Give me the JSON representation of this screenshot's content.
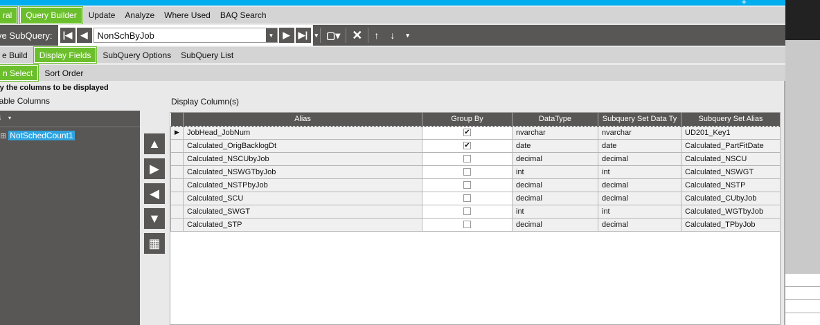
{
  "colors": {
    "accent": "#6cbf2c",
    "titlebar": "#00adef",
    "toolbar": "#595755"
  },
  "main_tabs": [
    {
      "label": "ral",
      "active": true
    },
    {
      "label": "Query Builder",
      "active": true
    },
    {
      "label": "Update"
    },
    {
      "label": "Analyze"
    },
    {
      "label": "Where Used"
    },
    {
      "label": "BAQ Search"
    }
  ],
  "toolbar": {
    "label": "ve SubQuery:",
    "subquery": "NonSchByJob"
  },
  "sub_tabs": [
    {
      "label": "e Build"
    },
    {
      "label": "Display Fields",
      "active": true
    },
    {
      "label": "SubQuery Options"
    },
    {
      "label": "SubQuery List"
    }
  ],
  "subsub_tabs": [
    {
      "label": "n Select",
      "active": true
    },
    {
      "label": "Sort Order"
    }
  ],
  "instruction": "fy the columns to be displayed",
  "available_label": "lable Columns",
  "display_label": "Display Column(s)",
  "tree": {
    "item": "NotSchedCount1"
  },
  "grid": {
    "headers": [
      "Alias",
      "Group By",
      "DataType",
      "Subquery Set Data Ty",
      "Subquery Set Alias"
    ],
    "rows": [
      {
        "alias": "JobHead_JobNum",
        "group_by": true,
        "datatype": "nvarchar",
        "set_type": "nvarchar",
        "set_alias": "UD201_Key1"
      },
      {
        "alias": "Calculated_OrigBacklogDt",
        "group_by": true,
        "datatype": "date",
        "set_type": "date",
        "set_alias": "Calculated_PartFitDate"
      },
      {
        "alias": "Calculated_NSCUbyJob",
        "group_by": false,
        "datatype": "decimal",
        "set_type": "decimal",
        "set_alias": "Calculated_NSCU"
      },
      {
        "alias": "Calculated_NSWGTbyJob",
        "group_by": false,
        "datatype": "int",
        "set_type": "int",
        "set_alias": "Calculated_NSWGT"
      },
      {
        "alias": "Calculated_NSTPbyJob",
        "group_by": false,
        "datatype": "decimal",
        "set_type": "decimal",
        "set_alias": "Calculated_NSTP"
      },
      {
        "alias": "Calculated_SCU",
        "group_by": false,
        "datatype": "decimal",
        "set_type": "decimal",
        "set_alias": "Calculated_CUbyJob"
      },
      {
        "alias": "Calculated_SWGT",
        "group_by": false,
        "datatype": "int",
        "set_type": "int",
        "set_alias": "Calculated_WGTbyJob"
      },
      {
        "alias": "Calculated_STP",
        "group_by": false,
        "datatype": "decimal",
        "set_type": "decimal",
        "set_alias": "Calculated_TPbyJob"
      }
    ]
  }
}
